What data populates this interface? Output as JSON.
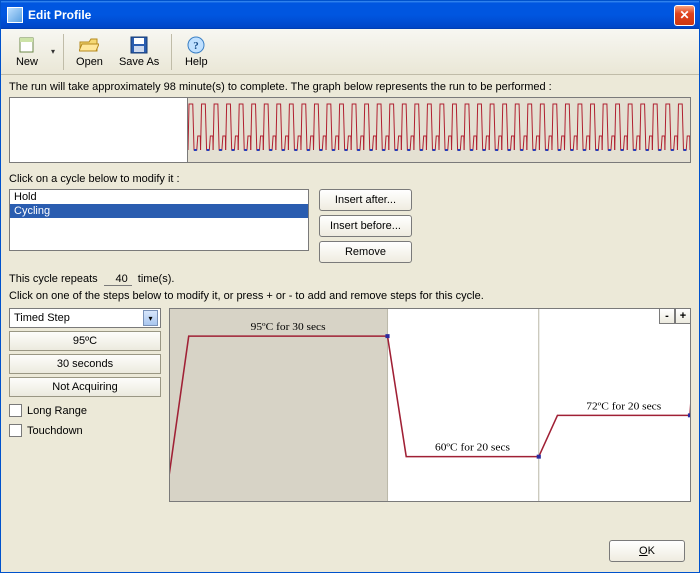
{
  "window": {
    "title": "Edit Profile"
  },
  "toolbar": {
    "new": "New",
    "open": "Open",
    "save_as": "Save As",
    "help": "Help"
  },
  "labels": {
    "run_summary": "The run will take approximately 98 minute(s) to complete. The graph below represents the run to be performed :",
    "click_cycle": "Click on a cycle below to modify it :",
    "repeat_prefix": "This cycle repeats",
    "repeat_value": "40",
    "repeat_suffix": "time(s).",
    "click_step": "Click on one of the steps below to modify it, or press + or - to add and remove steps for this cycle."
  },
  "cycles": {
    "items": [
      "Hold",
      "Cycling"
    ],
    "selected_index": 1,
    "btn_insert_after": "Insert after...",
    "btn_insert_before": "Insert before...",
    "btn_remove": "Remove"
  },
  "step_panel": {
    "type_select": "Timed Step",
    "temp": "95ºC",
    "duration": "30 seconds",
    "acquire": "Not Acquiring",
    "long_range": "Long Range",
    "touchdown": "Touchdown"
  },
  "buttons": {
    "minus": "-",
    "plus": "+",
    "ok": "OK"
  },
  "chart_data": {
    "type": "line",
    "title": "",
    "xlabel": "",
    "ylabel": "",
    "ylim": [
      50,
      100
    ],
    "steps": [
      {
        "temp_c": 95,
        "secs": 30,
        "label": "95ºC for 30 secs",
        "selected": true
      },
      {
        "temp_c": 60,
        "secs": 20,
        "label": "60ºC for 20 secs",
        "selected": false
      },
      {
        "temp_c": 72,
        "secs": 20,
        "label": "72ºC for 20 secs",
        "selected": false
      }
    ]
  }
}
